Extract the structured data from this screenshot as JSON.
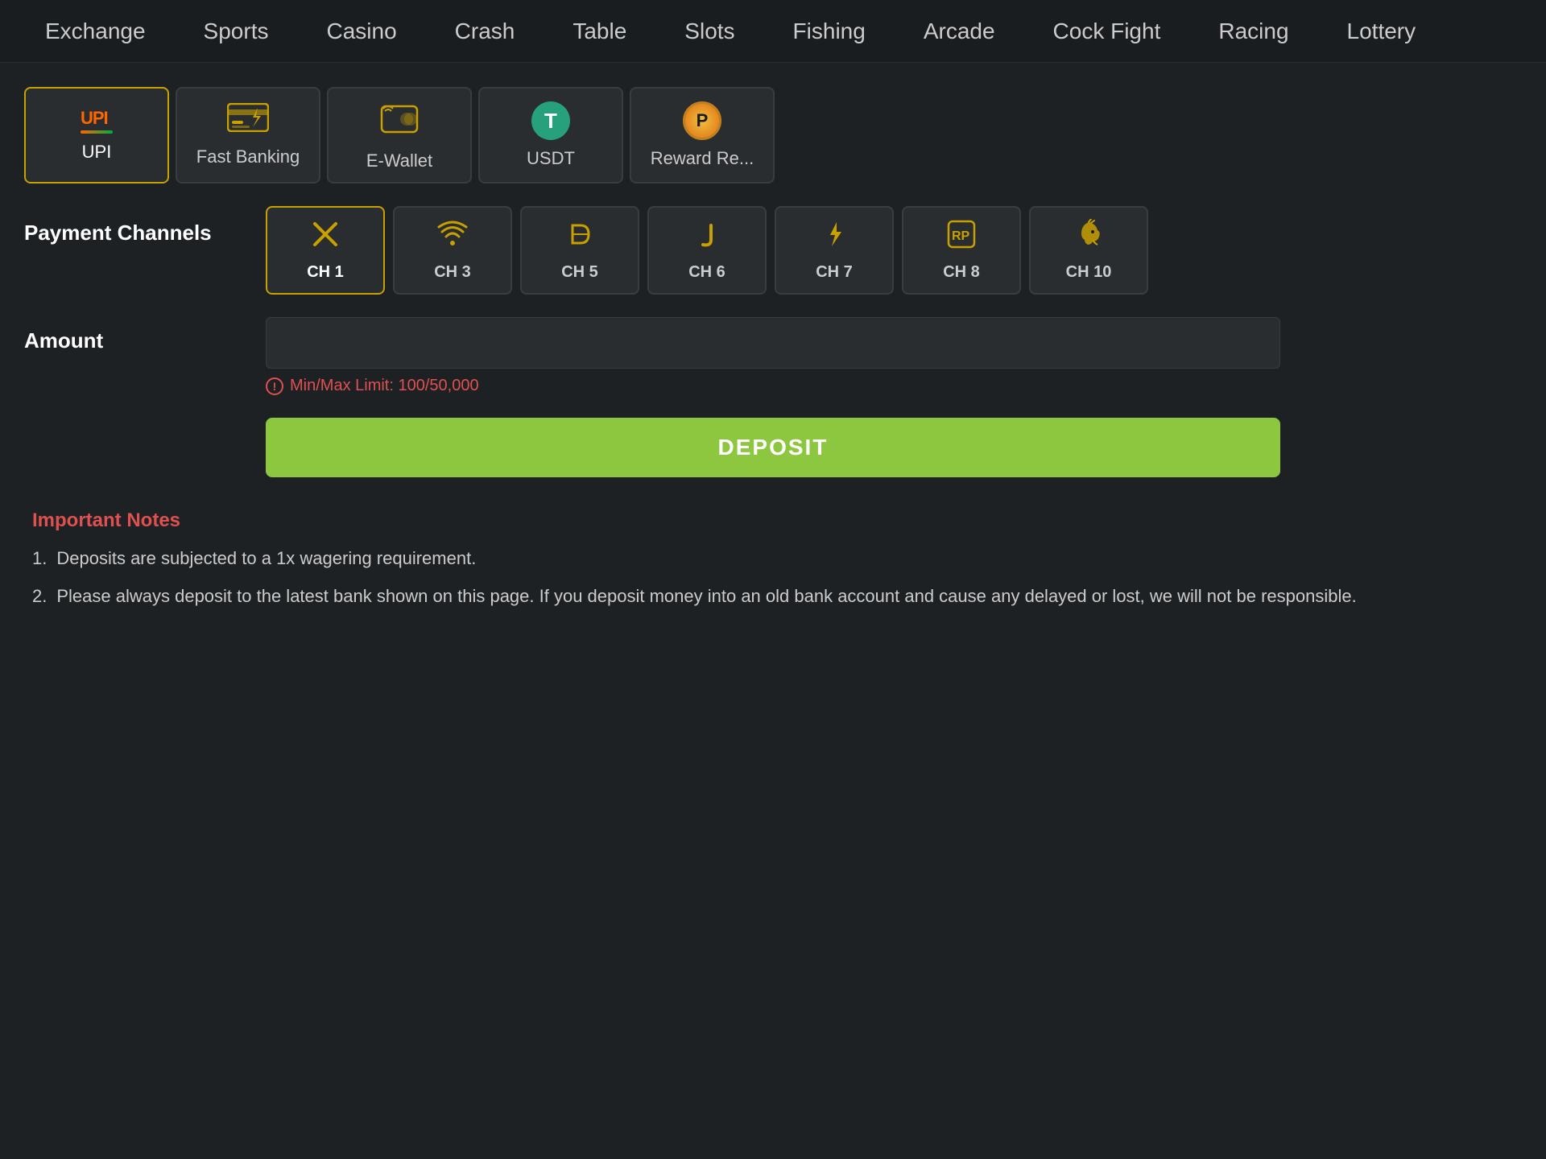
{
  "nav": {
    "items": [
      {
        "label": "Exchange",
        "id": "exchange"
      },
      {
        "label": "Sports",
        "id": "sports"
      },
      {
        "label": "Casino",
        "id": "casino"
      },
      {
        "label": "Crash",
        "id": "crash"
      },
      {
        "label": "Table",
        "id": "table"
      },
      {
        "label": "Slots",
        "id": "slots"
      },
      {
        "label": "Fishing",
        "id": "fishing"
      },
      {
        "label": "Arcade",
        "id": "arcade"
      },
      {
        "label": "Cock Fight",
        "id": "cockfight"
      },
      {
        "label": "Racing",
        "id": "racing"
      },
      {
        "label": "Lottery",
        "id": "lottery"
      }
    ]
  },
  "payment_methods": [
    {
      "id": "upi",
      "label": "UPI",
      "active": true
    },
    {
      "id": "fast-banking",
      "label": "Fast Banking",
      "active": false
    },
    {
      "id": "ewallet",
      "label": "E-Wallet",
      "active": false
    },
    {
      "id": "usdt",
      "label": "USDT",
      "active": false
    },
    {
      "id": "reward",
      "label": "Reward Re...",
      "active": false
    }
  ],
  "payment_channels": {
    "label": "Payment Channels",
    "channels": [
      {
        "id": "ch1",
        "label": "CH 1",
        "active": true
      },
      {
        "id": "ch3",
        "label": "CH 3",
        "active": false
      },
      {
        "id": "ch5",
        "label": "CH 5",
        "active": false
      },
      {
        "id": "ch6",
        "label": "CH 6",
        "active": false
      },
      {
        "id": "ch7",
        "label": "CH 7",
        "active": false
      },
      {
        "id": "ch8",
        "label": "CH 8",
        "active": false
      },
      {
        "id": "ch10",
        "label": "CH 10",
        "active": false
      }
    ]
  },
  "amount": {
    "label": "Amount",
    "placeholder": "",
    "min_max_hint": "Min/Max Limit: 100/50,000"
  },
  "deposit_button": {
    "label": "DEPOSIT"
  },
  "notes": {
    "title": "Important Notes",
    "items": [
      "Deposits are subjected to a 1x wagering requirement.",
      "Please always deposit to the latest bank shown on this page. If you deposit money into an old bank account and cause any delayed or lost, we will not be responsible."
    ]
  }
}
